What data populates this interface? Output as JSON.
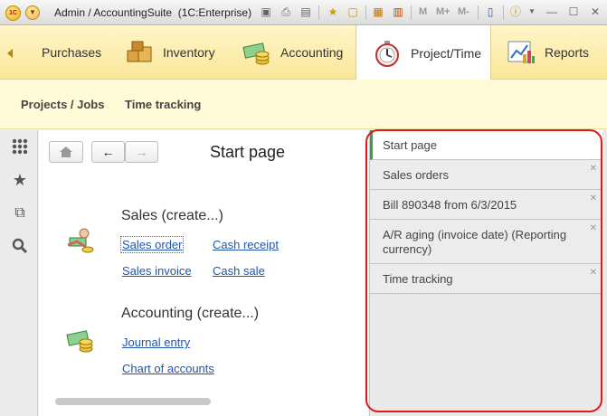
{
  "window": {
    "logo_text": "1C",
    "title": "Admin / AccountingSuite  (1C:Enterprise)",
    "toolbar": {
      "m_label": "M",
      "m_plus_label": "M+",
      "m_minus_label": "M-"
    }
  },
  "sections": [
    {
      "label": "Purchases",
      "icon": "purchases-icon"
    },
    {
      "label": "Inventory",
      "icon": "inventory-boxes-icon"
    },
    {
      "label": "Accounting",
      "icon": "accounting-money-icon"
    },
    {
      "label": "Project/Time",
      "icon": "stopwatch-icon",
      "active": true
    },
    {
      "label": "Reports",
      "icon": "reports-chart-icon"
    }
  ],
  "section_commands": {
    "projects": "Projects / Jobs",
    "time_tracking": "Time tracking"
  },
  "tools": [
    "grid-menu-icon",
    "star-icon",
    "history-icon",
    "search-icon"
  ],
  "start_page": {
    "title": "Start page",
    "sales": {
      "title": "Sales (create...)",
      "links": {
        "sales_order": "Sales order",
        "cash_receipt": "Cash receipt",
        "sales_invoice": "Sales invoice",
        "cash_sale": "Cash sale"
      }
    },
    "accounting": {
      "title": "Accounting (create...)",
      "links": {
        "journal_entry": "Journal entry",
        "chart_of_accounts": "Chart of accounts"
      }
    }
  },
  "open_windows": [
    {
      "label": "Start page",
      "active": true
    },
    {
      "label": "Sales orders"
    },
    {
      "label": "Bill 890348 from 6/3/2015"
    },
    {
      "label": "A/R aging (invoice date) (Reporting currency)"
    },
    {
      "label": "Time tracking"
    }
  ],
  "colors": {
    "accent_active": "#3aa04a",
    "link": "#2255aa",
    "highlight_border": "#e01818",
    "sections_bg": "#fbe79a"
  }
}
